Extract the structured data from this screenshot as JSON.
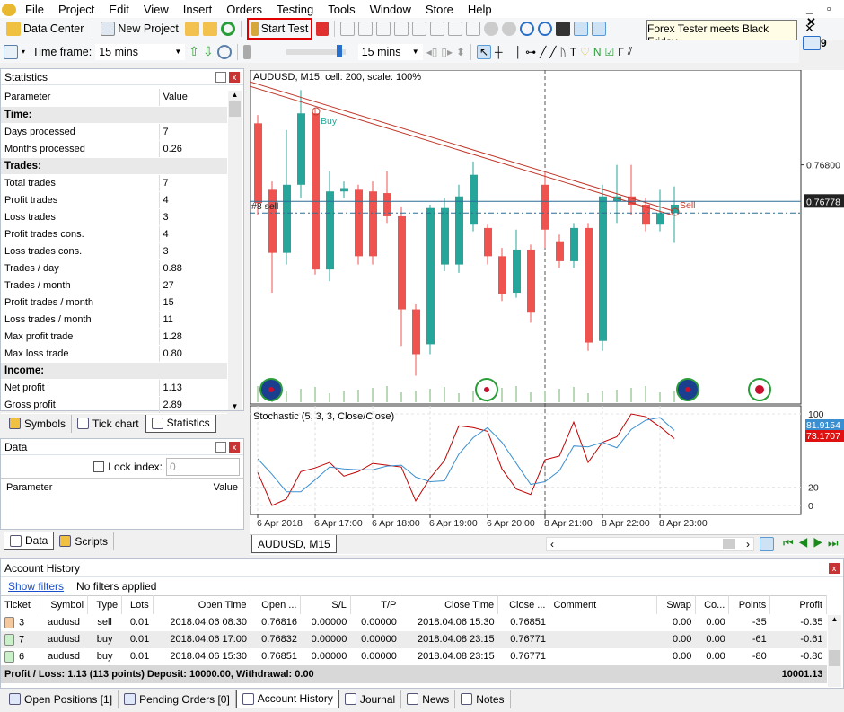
{
  "menu": [
    "File",
    "Project",
    "Edit",
    "View",
    "Insert",
    "Orders",
    "Testing",
    "Tools",
    "Window",
    "Store",
    "Help"
  ],
  "toolbar": {
    "data_center": "Data Center",
    "new_project": "New Project",
    "start_test": "Start Test",
    "tooltip": "Forex Tester meets Black Friday",
    "mail_count": "9",
    "timeframe_label": "Time frame:",
    "timeframe_value": "15 mins",
    "speed_value": "15 mins"
  },
  "statistics": {
    "title": "Statistics",
    "col_param": "Parameter",
    "col_value": "Value",
    "rows": [
      {
        "section": "Time:"
      },
      {
        "p": "Days processed",
        "v": "7"
      },
      {
        "p": "Months processed",
        "v": "0.26"
      },
      {
        "section": "Trades:"
      },
      {
        "p": "Total trades",
        "v": "7"
      },
      {
        "p": "Profit trades",
        "v": "4"
      },
      {
        "p": "Loss trades",
        "v": "3"
      },
      {
        "p": "Profit trades cons.",
        "v": "4"
      },
      {
        "p": "Loss trades cons.",
        "v": "3"
      },
      {
        "p": "Trades / day",
        "v": "0.88"
      },
      {
        "p": "Trades / month",
        "v": "27"
      },
      {
        "p": "Profit trades / month",
        "v": "15"
      },
      {
        "p": "Loss trades / month",
        "v": "11"
      },
      {
        "p": "Max profit trade",
        "v": "1.28"
      },
      {
        "p": "Max loss trade",
        "v": "0.80"
      },
      {
        "section": "Income:"
      },
      {
        "p": "Net profit",
        "v": "1.13"
      },
      {
        "p": "Gross profit",
        "v": "2.89"
      }
    ],
    "tabs": [
      "Symbols",
      "Tick chart",
      "Statistics"
    ]
  },
  "data_panel": {
    "title": "Data",
    "lock_index": "Lock index:",
    "lock_value": "0",
    "col_param": "Parameter",
    "col_value": "Value",
    "tabs": [
      "Data",
      "Scripts"
    ]
  },
  "chart": {
    "title": "AUDUSD, M15, cell: 200, scale: 100%",
    "buy_label": "Buy",
    "sell_label": "Sell",
    "order_label": "#8 sell",
    "price_ticks": [
      "0.76800"
    ],
    "current_price": "0.76778",
    "tab": "AUDUSD, M15",
    "price_range": [
      0.76656,
      0.76856
    ],
    "tick_price": 0.768,
    "current": 0.76778,
    "order_price": 0.76771,
    "colors": {
      "bull": "#26a69a",
      "bear": "#ef5350",
      "trend": "#c0392b",
      "price_line": "#2a6f97"
    },
    "candles": [
      [
        0.76825,
        0.7683,
        0.7677,
        0.76777
      ],
      [
        0.76785,
        0.7679,
        0.76723,
        0.76747
      ],
      [
        0.76747,
        0.76821,
        0.7674,
        0.76788
      ],
      [
        0.76788,
        0.76845,
        0.7678,
        0.76831
      ],
      [
        0.76831,
        0.76834,
        0.76734,
        0.76737
      ],
      [
        0.76737,
        0.76796,
        0.7673,
        0.76784
      ],
      [
        0.76784,
        0.7679,
        0.7678,
        0.76786
      ],
      [
        0.76785,
        0.76788,
        0.7674,
        0.76745
      ],
      [
        0.76784,
        0.7679,
        0.7674,
        0.76745
      ],
      [
        0.76783,
        0.76796,
        0.76765,
        0.76769
      ],
      [
        0.76769,
        0.76775,
        0.76691,
        0.76713
      ],
      [
        0.76713,
        0.76716,
        0.76673,
        0.76686
      ],
      [
        0.76692,
        0.76776,
        0.76686,
        0.76774
      ],
      [
        0.7674,
        0.7678,
        0.76736,
        0.76774
      ],
      [
        0.7674,
        0.76788,
        0.76735,
        0.76781
      ],
      [
        0.76764,
        0.76802,
        0.7676,
        0.76794
      ],
      [
        0.76762,
        0.76764,
        0.7674,
        0.76745
      ],
      [
        0.76745,
        0.7675,
        0.76718,
        0.76722
      ],
      [
        0.76723,
        0.76761,
        0.7672,
        0.76749
      ],
      [
        0.76749,
        0.76752,
        0.76705,
        0.76711
      ],
      [
        0.76788,
        0.76796,
        0.7675,
        0.76761
      ],
      [
        0.76754,
        0.76758,
        0.76738,
        0.76742
      ],
      [
        0.76742,
        0.76765,
        0.76738,
        0.76762
      ],
      [
        0.76762,
        0.76765,
        0.76688,
        0.76693
      ],
      [
        0.76694,
        0.76788,
        0.76688,
        0.76781
      ],
      [
        0.76778,
        0.768,
        0.76765,
        0.76781
      ],
      [
        0.76781,
        0.768,
        0.7677,
        0.76776
      ],
      [
        0.76776,
        0.7678,
        0.7676,
        0.76764
      ],
      [
        0.76764,
        0.76785,
        0.7676,
        0.76771
      ],
      [
        0.76771,
        0.76787,
        0.76753,
        0.76776
      ]
    ],
    "time_labels": [
      "6 Apr 2018",
      "6 Apr 17:00",
      "6 Apr 18:00",
      "6 Apr 19:00",
      "6 Apr 20:00",
      "8 Apr 21:00",
      "8 Apr 22:00",
      "8 Apr 23:00"
    ],
    "flags": [
      "uk-flag",
      "us-flag",
      "au-flag",
      "jp-flag"
    ]
  },
  "stochastic": {
    "title": "Stochastic (5, 3, 3, Close/Close)",
    "ticks": [
      "100",
      "20",
      "0"
    ],
    "main_value": "81.9154",
    "signal_value": "73.1707",
    "k": [
      36,
      0,
      7,
      37,
      41,
      47,
      32,
      37,
      46,
      44,
      42,
      5,
      30,
      49,
      87,
      85,
      81,
      40,
      18,
      12,
      50,
      54,
      91,
      47,
      69,
      75,
      100,
      97,
      86,
      73
    ],
    "d": [
      51,
      34,
      15,
      15,
      28,
      42,
      40,
      39,
      39,
      43,
      44,
      31,
      26,
      27,
      56,
      74,
      85,
      69,
      46,
      23,
      26,
      38,
      65,
      64,
      69,
      63,
      83,
      93,
      96,
      82
    ],
    "colors": {
      "k": "#c00000",
      "d": "#3a8fd0"
    }
  },
  "history": {
    "title": "Account History",
    "show_filters": "Show filters",
    "filters_text": "No filters applied",
    "columns": [
      "Ticket",
      "Symbol",
      "Type",
      "Lots",
      "Open Time",
      "Open ...",
      "S/L",
      "T/P",
      "Close Time",
      "Close ...",
      "Comment",
      "Swap",
      "Co...",
      "Points",
      "Profit"
    ],
    "rows": [
      [
        "3",
        "audusd",
        "sell",
        "0.01",
        "2018.04.06 08:30",
        "0.76816",
        "0.00000",
        "0.00000",
        "2018.04.06 15:30",
        "0.76851",
        "",
        "0.00",
        "0.00",
        "-35",
        "-0.35"
      ],
      [
        "7",
        "audusd",
        "buy",
        "0.01",
        "2018.04.06 17:00",
        "0.76832",
        "0.00000",
        "0.00000",
        "2018.04.08 23:15",
        "0.76771",
        "",
        "0.00",
        "0.00",
        "-61",
        "-0.61"
      ],
      [
        "6",
        "audusd",
        "buy",
        "0.01",
        "2018.04.06 15:30",
        "0.76851",
        "0.00000",
        "0.00000",
        "2018.04.08 23:15",
        "0.76771",
        "",
        "0.00",
        "0.00",
        "-80",
        "-0.80"
      ]
    ],
    "summary": "Profit / Loss: 1.13 (113 points) Deposit: 10000.00, Withdrawal: 0.00",
    "summary_total": "10001.13"
  },
  "bottom_tabs": [
    "Open Positions [1]",
    "Pending Orders [0]",
    "Account History",
    "Journal",
    "News",
    "Notes"
  ]
}
